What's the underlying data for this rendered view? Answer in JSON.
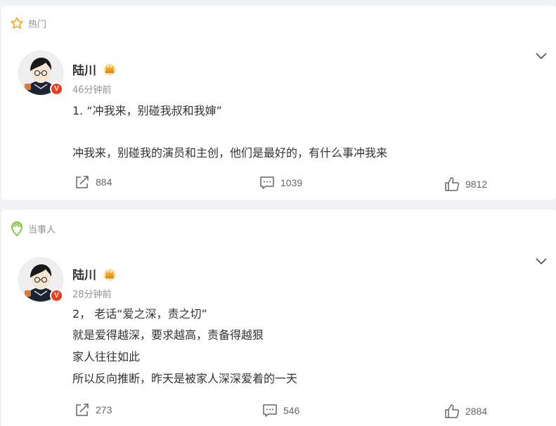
{
  "posts": [
    {
      "section_label": "热门",
      "section_icon": "star-icon",
      "user_name": "陆川",
      "time": "46分钟前",
      "lines": [
        "1. “冲我来，别碰我叔和我婶”",
        "冲我来，别碰我的演员和主创，他们是最好的，有什么事冲我来"
      ],
      "reposts": "884",
      "comments": "1039",
      "likes": "9812"
    },
    {
      "section_label": "当事人",
      "section_icon": "location-pin-icon",
      "user_name": "陆川",
      "time": "28分钟前",
      "lines": [
        "2，  老话“爱之深，责之切”",
        "就是爱得越深，要求越高，责备得越狠",
        "家人往往如此",
        "所以反向推断，昨天是被家人深深爱着的一天"
      ],
      "reposts": "273",
      "comments": "546",
      "likes": "2884"
    }
  ],
  "colors": {
    "background": "#f1f2f5",
    "card": "#ffffff",
    "verified_badge": "#f53b17",
    "star": "#f7a823",
    "pin": "#8bc34a",
    "muted_text": "#939393"
  }
}
